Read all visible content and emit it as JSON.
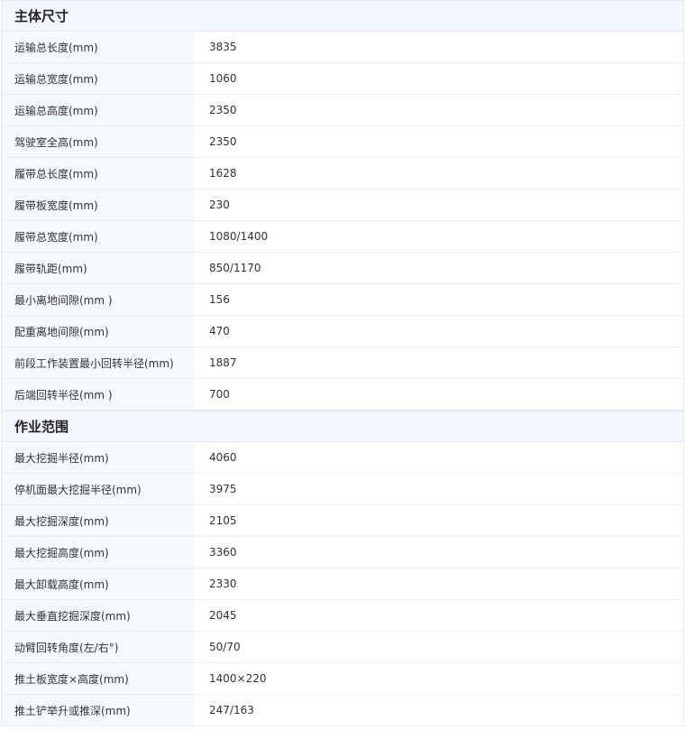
{
  "sections": [
    {
      "title": "主体尺寸",
      "rows": [
        {
          "label": "运输总长度(mm)",
          "value": "3835"
        },
        {
          "label": "运输总宽度(mm)",
          "value": "1060"
        },
        {
          "label": "运输总高度(mm)",
          "value": "2350"
        },
        {
          "label": "驾驶室全高(mm)",
          "value": "2350"
        },
        {
          "label": "履带总长度(mm)",
          "value": "1628"
        },
        {
          "label": "履带板宽度(mm)",
          "value": "230"
        },
        {
          "label": "履带总宽度(mm)",
          "value": "1080/1400"
        },
        {
          "label": "履带轨距(mm)",
          "value": "850/1170"
        },
        {
          "label": "最小离地间隙(mm )",
          "value": "156"
        },
        {
          "label": "配重离地间隙(mm)",
          "value": "470"
        },
        {
          "label": "前段工作装置最小回转半径(mm)",
          "value": "1887"
        },
        {
          "label": "后端回转半径(mm )",
          "value": "700"
        }
      ]
    },
    {
      "title": "作业范围",
      "rows": [
        {
          "label": "最大挖掘半径(mm)",
          "value": "4060"
        },
        {
          "label": "停机面最大挖掘半径(mm)",
          "value": "3975"
        },
        {
          "label": "最大挖掘深度(mm)",
          "value": "2105"
        },
        {
          "label": "最大挖掘高度(mm)",
          "value": "3360"
        },
        {
          "label": "最大卸载高度(mm)",
          "value": "2330"
        },
        {
          "label": "最大垂直挖掘深度(mm)",
          "value": "2045"
        },
        {
          "label": "动臂回转角度(左/右°)",
          "value": "50/70"
        },
        {
          "label": "推土板宽度×高度(mm)",
          "value": "1400×220"
        },
        {
          "label": "推土铲举升或推深(mm)",
          "value": "247/163"
        }
      ]
    }
  ]
}
